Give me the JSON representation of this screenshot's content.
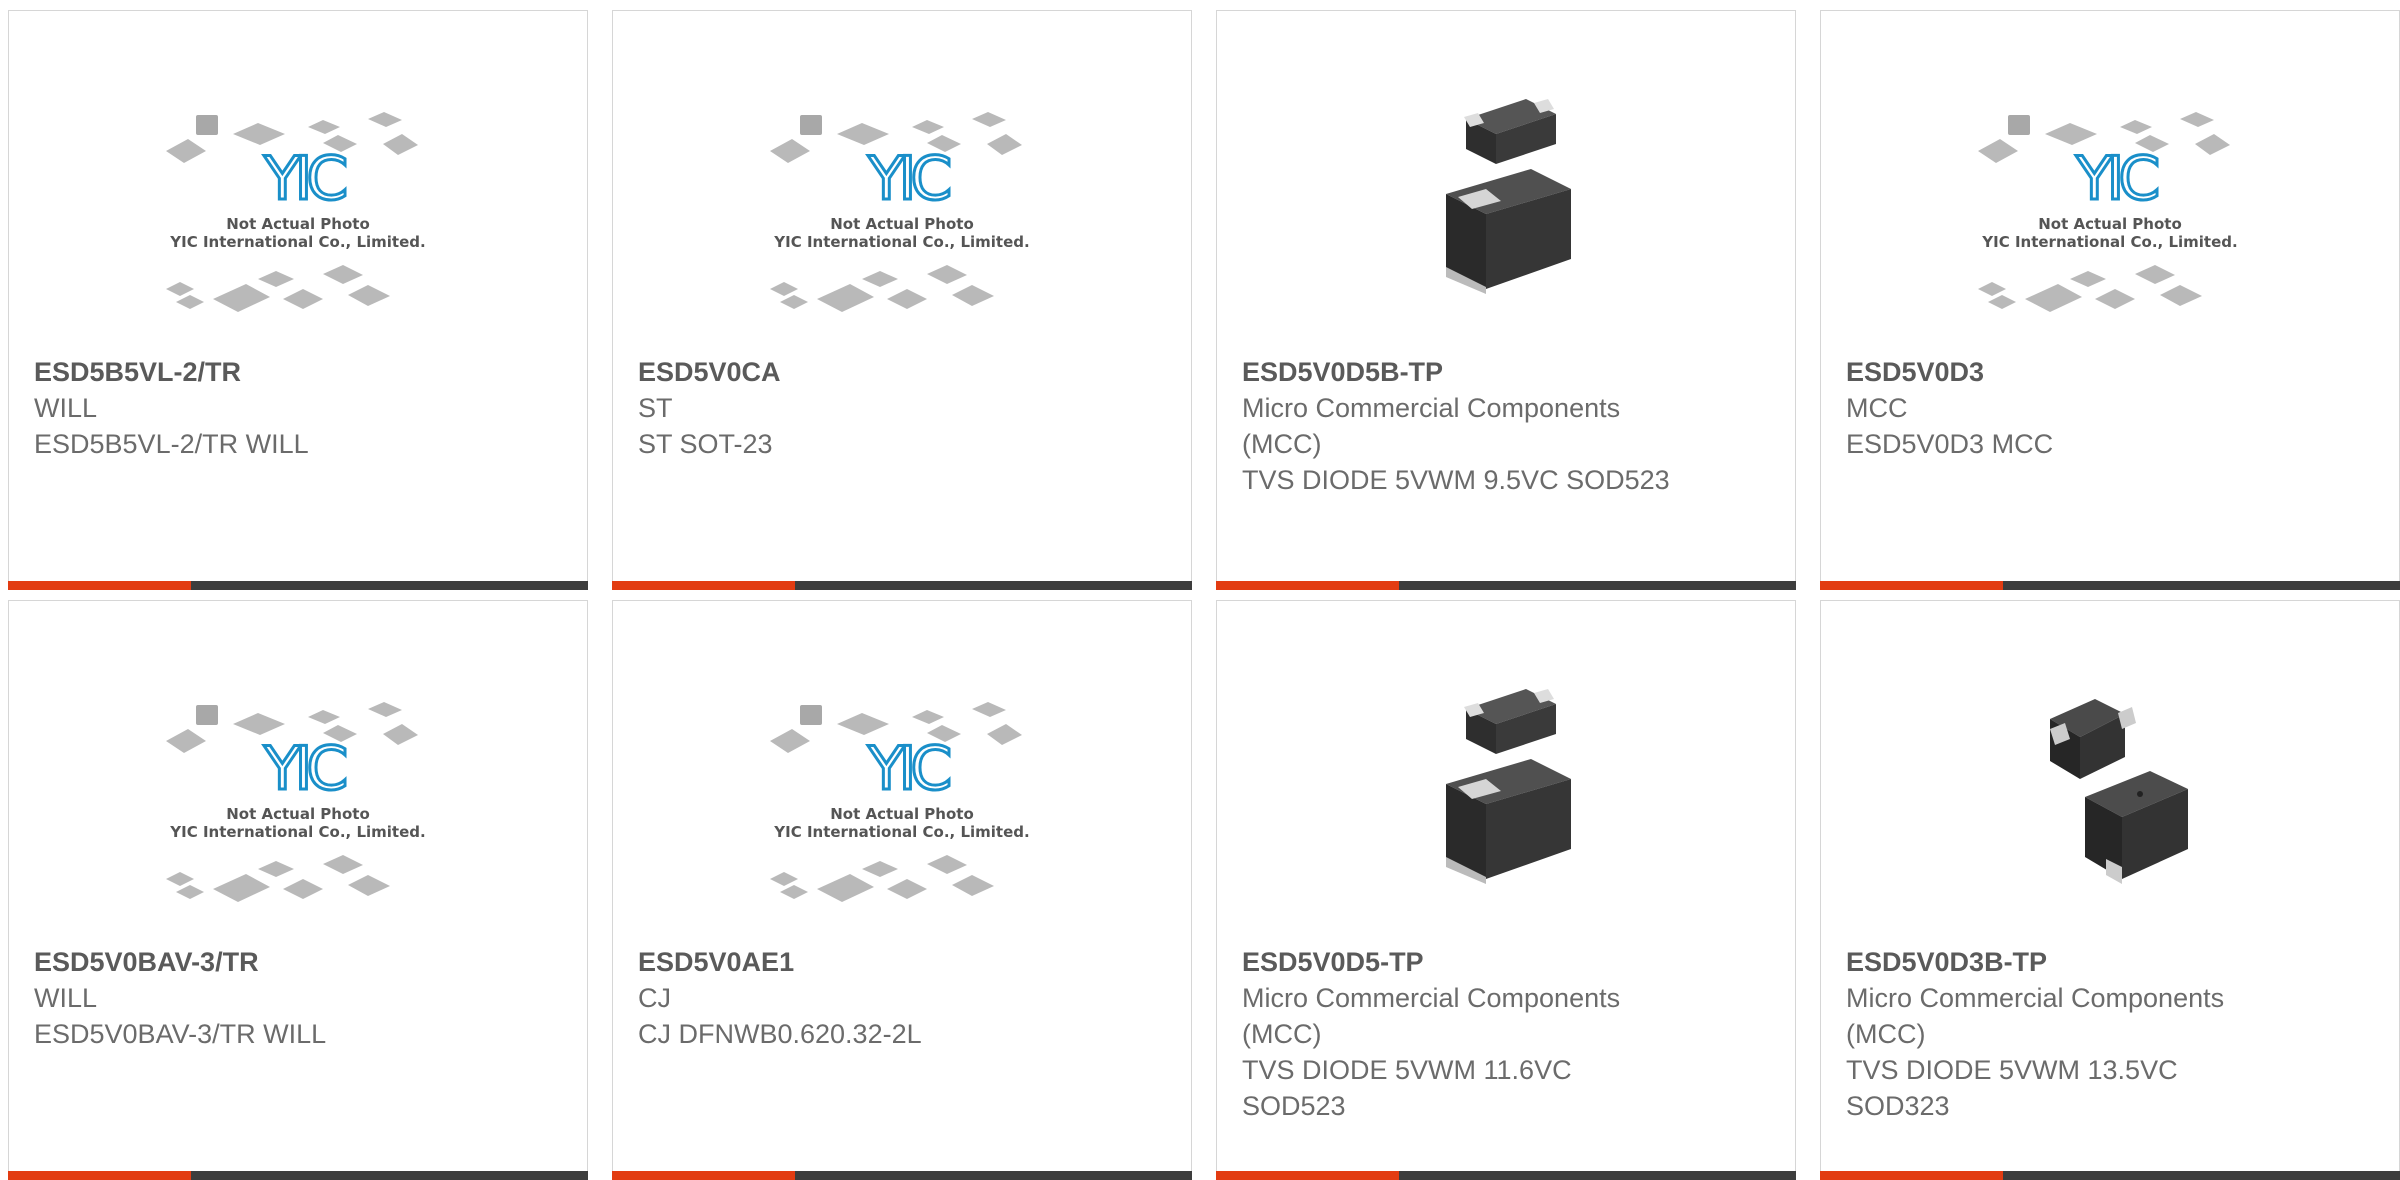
{
  "placeholder_image": {
    "line1": "Not Actual Photo",
    "line2": "YIC International Co., Limited."
  },
  "products": [
    {
      "part": "ESD5B5VL-2/TR",
      "maker": "WILL",
      "desc": "ESD5B5VL-2/TR WILL",
      "image": "placeholder"
    },
    {
      "part": "ESD5V0CA",
      "maker": "ST",
      "desc": "ST SOT-23",
      "image": "placeholder"
    },
    {
      "part": "ESD5V0D5B-TP",
      "maker": "Micro Commercial Components (MCC)",
      "desc": "TVS DIODE 5VWM 9.5VC SOD523",
      "image": "sod523"
    },
    {
      "part": "ESD5V0D3",
      "maker": "MCC",
      "desc": "ESD5V0D3 MCC",
      "image": "placeholder"
    },
    {
      "part": "ESD5V0BAV-3/TR",
      "maker": "WILL",
      "desc": "ESD5V0BAV-3/TR WILL",
      "image": "placeholder"
    },
    {
      "part": "ESD5V0AE1",
      "maker": "CJ",
      "desc": "CJ DFNWB0.620.32-2L",
      "image": "placeholder"
    },
    {
      "part": "ESD5V0D5-TP",
      "maker": "Micro Commercial Components (MCC)",
      "desc": "TVS DIODE 5VWM 11.6VC SOD523",
      "image": "sod523"
    },
    {
      "part": "ESD5V0D3B-TP",
      "maker": "Micro Commercial Components (MCC)",
      "desc": "TVS DIODE 5VWM 13.5VC SOD323",
      "image": "sod323"
    }
  ],
  "colors": {
    "accent": "#e23c12",
    "bar": "#3d3d3d",
    "logo": "#1a8fc9"
  }
}
